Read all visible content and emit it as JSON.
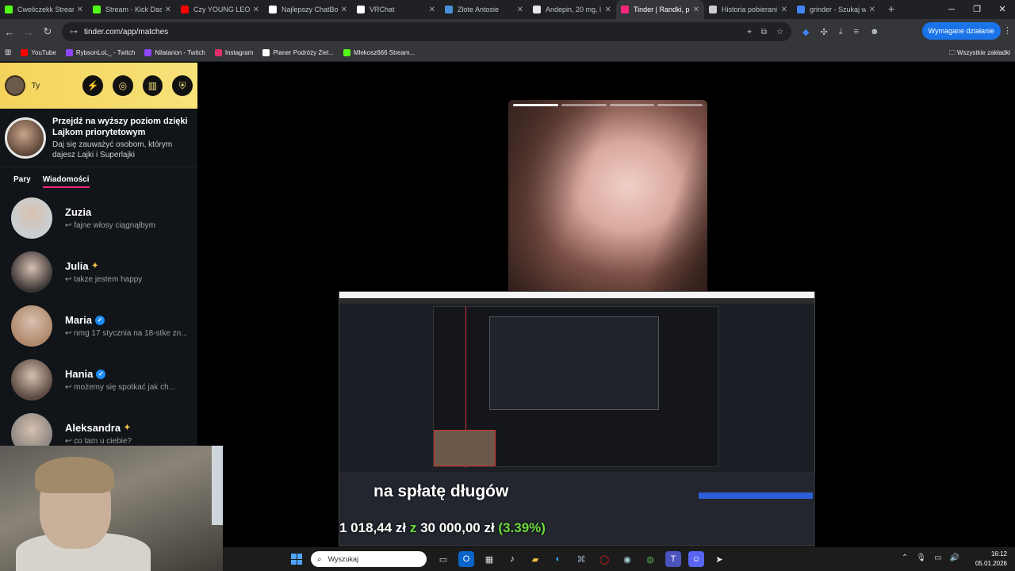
{
  "browser": {
    "tabs": [
      {
        "title": "Cweliczekk Stream",
        "color": "#53fc18"
      },
      {
        "title": "Stream - Kick Dash",
        "color": "#53fc18"
      },
      {
        "title": "Czy YOUNG LEOSI",
        "color": "#ff0000"
      },
      {
        "title": "Najlepszy ChatBot",
        "color": "#ffffff"
      },
      {
        "title": "VRChat",
        "color": "#ffffff"
      },
      {
        "title": "Złote Antosie",
        "color": "#4a90d9"
      },
      {
        "title": "Andepin, 20 mg, l",
        "color": "#e8e8e8"
      },
      {
        "title": "Tinder | Randki, p",
        "color": "#fd267d"
      },
      {
        "title": "Historia pobierani",
        "color": "#cccccc"
      },
      {
        "title": "grinder - Szukaj w",
        "color": "#4285f4"
      }
    ],
    "active_tab_index": 7,
    "new_tab": "+",
    "url": "tinder.com/app/matches",
    "required_action": "Wymagane działanie",
    "bookmarks": [
      {
        "label": "YouTube",
        "color": "#ff0000"
      },
      {
        "label": "RybsonLoL_ - Twitch",
        "color": "#9146ff"
      },
      {
        "label": "Nilatarion - Twitch",
        "color": "#9146ff"
      },
      {
        "label": "Instagram",
        "color": "#e1306c"
      },
      {
        "label": "Planer Podróży Ziel...",
        "color": "#ffffff"
      },
      {
        "label": "Mlekosz666 Stream...",
        "color": "#53fc18"
      }
    ],
    "all_bookmarks": "Wszystkie zakładki"
  },
  "sidebar": {
    "me_label": "Ty",
    "promo_title": "Przejdź na wyższy poziom dzięki Lajkom priorytetowym",
    "promo_desc": "Daj się zauważyć osobom, którym dajesz Lajki i Superlajki",
    "tab_pairs": "Pary",
    "tab_messages": "Wiadomości",
    "messages": [
      {
        "name": "Zuzia",
        "preview": "fajne włosy ciągnąłbym",
        "badge": "",
        "avatar": "#c9d0d4"
      },
      {
        "name": "Julia",
        "preview": "takze jestem happy",
        "badge": "star",
        "avatar": "#3a3535"
      },
      {
        "name": "Maria",
        "preview": "nmg 17 stycznia na 18-stke zn...",
        "badge": "verified",
        "avatar": "#b0886a"
      },
      {
        "name": "Hania",
        "preview": "możemy się spotkać jak ch...",
        "badge": "verified",
        "avatar": "#5a4a42"
      },
      {
        "name": "Aleksandra",
        "preview": "co tam u ciebie?",
        "badge": "star",
        "avatar": "#8a8580"
      }
    ]
  },
  "overlay": {
    "caption": "na spłatę długów",
    "amount": "1 018,44 zł",
    "separator": "z",
    "goal": "30 000,00 zł",
    "percent": "(3.39%)"
  },
  "taskbar": {
    "search_placeholder": "Wyszukaj",
    "time": "16:12",
    "date": "05.01.2026"
  }
}
